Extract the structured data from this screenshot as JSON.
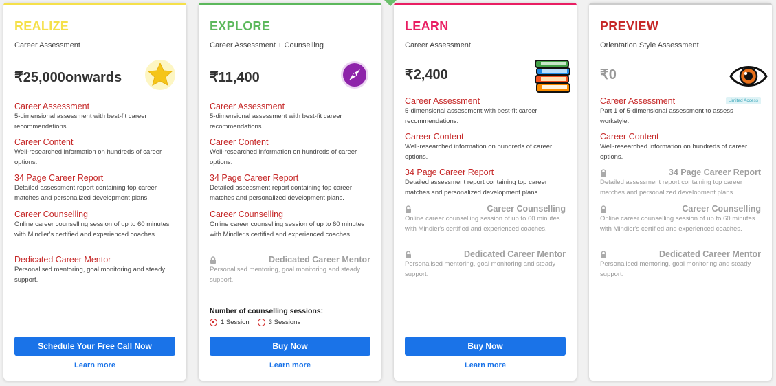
{
  "colors": {
    "realize": "#f5e04a",
    "explore": "#5cb85c",
    "learn": "#e91e63",
    "preview": "#c62828",
    "topbar_preview": "#cccccc",
    "button": "#1a73e8"
  },
  "plans": [
    {
      "name": "REALIZE",
      "subtitle": "Career Assessment",
      "price": "₹25,000onwards",
      "icon": "star-icon",
      "features": [
        {
          "title": "Career Assessment",
          "desc": "5-dimensional assessment with best-fit career recommendations."
        },
        {
          "title": "Career Content",
          "desc": "Well-researched information on hundreds of career options."
        },
        {
          "title": "34 Page Career Report",
          "desc": "Detailed assessment report containing top career matches and personalized development plans."
        },
        {
          "title": "Career Counselling",
          "desc": "Online career counselling session of up to 60 minutes with Mindler's certified and experienced coaches."
        },
        {
          "title": "Dedicated Career Mentor",
          "desc": "Personalised mentoring, goal monitoring and steady support."
        }
      ],
      "button": "Schedule Your Free Call Now",
      "learn_more": "Learn more"
    },
    {
      "name": "EXPLORE",
      "subtitle": "Career Assessment + Counselling",
      "price": "₹11,400",
      "icon": "compass-icon",
      "features": [
        {
          "title": "Career Assessment",
          "desc": "5-dimensional assessment with best-fit career recommendations."
        },
        {
          "title": "Career Content",
          "desc": "Well-researched information on hundreds of career options."
        },
        {
          "title": "34 Page Career Report",
          "desc": "Detailed assessment report containing top career matches and personalized development plans."
        },
        {
          "title": "Career Counselling",
          "desc": "Online career counselling session of up to 60 minutes with Mindler's certified and experienced coaches."
        },
        {
          "title": "Dedicated Career Mentor",
          "desc": "Personalised mentoring, goal monitoring and steady support.",
          "locked": true
        }
      ],
      "sessions": {
        "label": "Number of counselling sessions:",
        "options": [
          "1 Session",
          "3 Sessions"
        ],
        "selected": "1 Session"
      },
      "button": "Buy Now",
      "learn_more": "Learn more"
    },
    {
      "name": "LEARN",
      "subtitle": "Career Assessment",
      "price": "₹2,400",
      "icon": "books-icon",
      "features": [
        {
          "title": "Career Assessment",
          "desc": "5-dimensional assessment with best-fit career recommendations."
        },
        {
          "title": "Career Content",
          "desc": "Well-researched information on hundreds of career options."
        },
        {
          "title": "34 Page Career Report",
          "desc": "Detailed assessment report containing top career matches and personalized development plans."
        },
        {
          "title": "Career Counselling",
          "desc": "Online career counselling session of up to 60 minutes with Mindler's certified and experienced coaches.",
          "locked": true
        },
        {
          "title": "Dedicated Career Mentor",
          "desc": "Personalised mentoring, goal monitoring and steady support.",
          "locked": true
        }
      ],
      "button": "Buy Now",
      "learn_more": "Learn more"
    },
    {
      "name": "PREVIEW",
      "subtitle": "Orientation Style Assessment",
      "price": "₹0",
      "icon": "eye-icon",
      "features": [
        {
          "title": "Career Assessment",
          "desc": "Part 1 of 5-dimensional assessment to assess workstyle.",
          "badge": "Limited Access"
        },
        {
          "title": "Career Content",
          "desc": "Well-researched information on hundreds of career options."
        },
        {
          "title": "34 Page Career Report",
          "desc": "Detailed assessment report containing top career matches and personalized development plans.",
          "locked": true
        },
        {
          "title": "Career Counselling",
          "desc": "Online career counselling session of up to 60 minutes with Mindler's certified and experienced coaches.",
          "locked": true
        },
        {
          "title": "Dedicated Career Mentor",
          "desc": "Personalised mentoring, goal monitoring and steady support.",
          "locked": true
        }
      ]
    }
  ]
}
